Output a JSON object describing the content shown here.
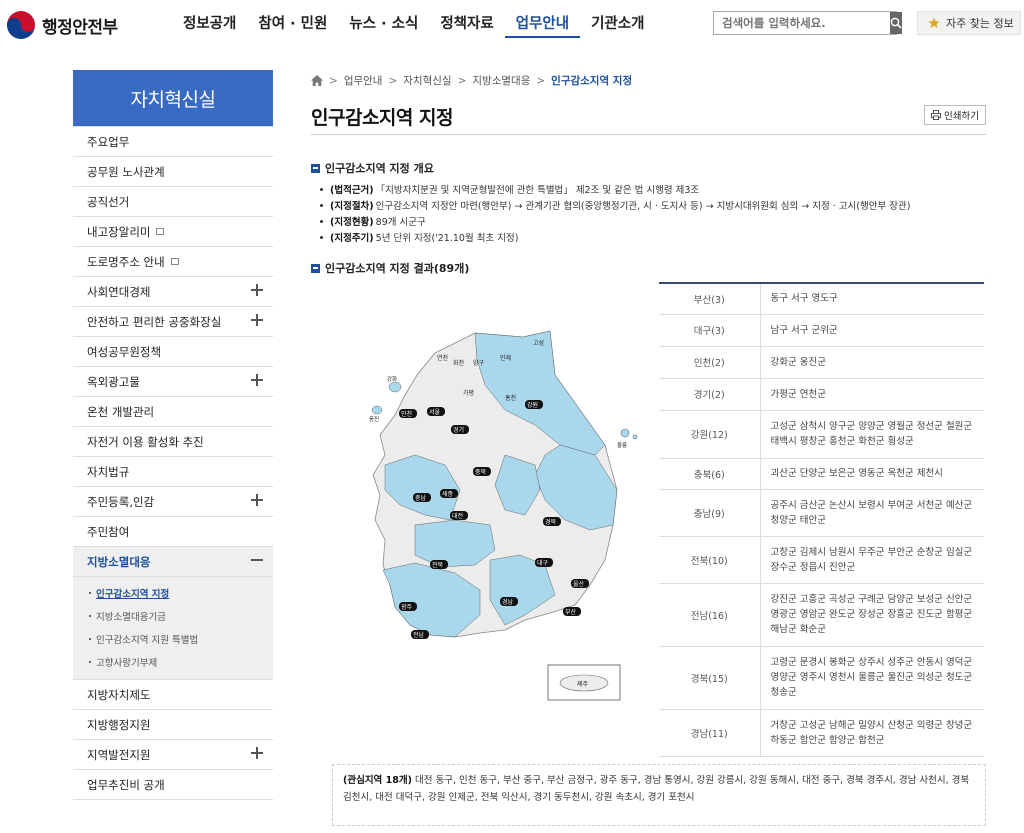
{
  "header": {
    "logo_text": "행정안전부",
    "nav": [
      "정보공개",
      "참여 · 민원",
      "뉴스 · 소식",
      "정책자료",
      "업무안내",
      "기관소개"
    ],
    "active_nav": 4,
    "search_placeholder": "검색어를 입력하세요.",
    "faq_label": "자주 찾는 정보"
  },
  "sidebar": {
    "title": "자치혁신실",
    "items": [
      {
        "label": "주요업무"
      },
      {
        "label": "공무원 노사관계"
      },
      {
        "label": "공직선거"
      },
      {
        "label": "내고장알리미"
      },
      {
        "label": "도로명주소 안내"
      },
      {
        "label": "사회연대경제"
      },
      {
        "label": "안전하고 편리한 공중화장실"
      },
      {
        "label": "여성공무원정책"
      },
      {
        "label": "옥외광고물"
      },
      {
        "label": "온천 개발관리"
      },
      {
        "label": "자전거 이용 활성화 추진"
      },
      {
        "label": "자치법규"
      },
      {
        "label": "주민등록,인감"
      },
      {
        "label": "주민참여"
      },
      {
        "label": "지방소멸대응"
      },
      {
        "label": "지방자치제도"
      },
      {
        "label": "지방행정지원"
      },
      {
        "label": "지역발전지원"
      },
      {
        "label": "업무추진비 공개"
      }
    ],
    "sub_items": [
      "인구감소지역 지정",
      "지방소멸대응기금",
      "인구감소지역 지원 특별법",
      "고향사랑기부제"
    ]
  },
  "breadcrumb": [
    "업무안내",
    "자치혁신실",
    "지방소멸대응",
    "인구감소지역 지정"
  ],
  "page_title": "인구감소지역 지정",
  "print_label": "인쇄하기",
  "section1": {
    "title": "인구감소지역 지정 개요",
    "bullets": [
      {
        "key": "(법적근거)",
        "text": "「지방자치분권 및 지역균형발전에 관한 특별법」 제2조 및 같은 법 시행령 제3조"
      },
      {
        "key": "(지정절차)",
        "text": "인구감소지역 지정안 마련(행안부) → 관계기관 협의(중앙행정기관, 시 · 도지사 등) → 지방시대위원회 심의 → 지정 · 고시(행안부 장관)"
      },
      {
        "key": "(지정현황)",
        "text": "89개 시군구"
      },
      {
        "key": "(지정주기)",
        "text": "5년 단위 지정('21.10월 최초 지정)"
      }
    ]
  },
  "section2": {
    "title": "인구감소지역 지정 결과(89개)"
  },
  "map": {
    "labels": [
      "화천",
      "양구",
      "인제",
      "고성",
      "홍천",
      "강화",
      "옹진",
      "가평",
      "연천",
      "서울",
      "인천",
      "경기",
      "강원",
      "울릉",
      "충북",
      "충남",
      "세종",
      "대전",
      "전북",
      "경북",
      "대구",
      "울산",
      "부산",
      "광주",
      "전남",
      "경남",
      "제주"
    ],
    "legend": "제주"
  },
  "table": [
    {
      "region": "부산(3)",
      "list": "동구 서구 영도구"
    },
    {
      "region": "대구(3)",
      "list": "남구 서구 군위군"
    },
    {
      "region": "인천(2)",
      "list": "강화군 옹진군"
    },
    {
      "region": "경기(2)",
      "list": "가평군 연천군"
    },
    {
      "region": "강원(12)",
      "list": "고성군 삼척시 양구군 양양군 영월군 정선군 철원군 태백시 평창군 홍천군 화천군 횡성군"
    },
    {
      "region": "충북(6)",
      "list": "괴산군 단양군 보은군 영동군 옥천군 제천시"
    },
    {
      "region": "충남(9)",
      "list": "공주시 금산군 논산시 보령시 부여군 서천군 예산군 청양군 태안군"
    },
    {
      "region": "전북(10)",
      "list": "고창군 김제시 남원시 무주군 부안군 순창군 임실군 장수군 정읍시 진안군"
    },
    {
      "region": "전남(16)",
      "list": "강진군 고흥군 곡성군 구례군 담양군 보성군 신안군 영광군 영암군 완도군 장성군 장흥군 진도군 함평군 해남군 화순군"
    },
    {
      "region": "경북(15)",
      "list": "고령군 문경시 봉화군 상주시 성주군 안동시 영덕군 영양군 영주시 영천시 울릉군 울진군 의성군 청도군 청송군"
    },
    {
      "region": "경남(11)",
      "list": "거창군 고성군 남해군 밀양시 산청군 의령군 창녕군 하동군 함안군 함양군 합천군"
    }
  ],
  "note": {
    "key": "(관심지역 18개)",
    "text": "대전 동구, 인천 동구, 부산 중구, 부산 금정구, 광주 동구, 경남 통영시, 강원 강릉시, 강원 동해시, 대전 중구, 경북 경주시, 경남 사천시, 경북 김천시, 대전 대덕구, 강원 인제군, 전북 익산시, 경기 동두천시, 강원 속초시, 경기 포천시"
  },
  "colors": {
    "accent": "#1d4f9c",
    "side_title_bg": "#3a6bc3",
    "map_designated": "#a9d8ec",
    "map_other": "#ececec"
  }
}
